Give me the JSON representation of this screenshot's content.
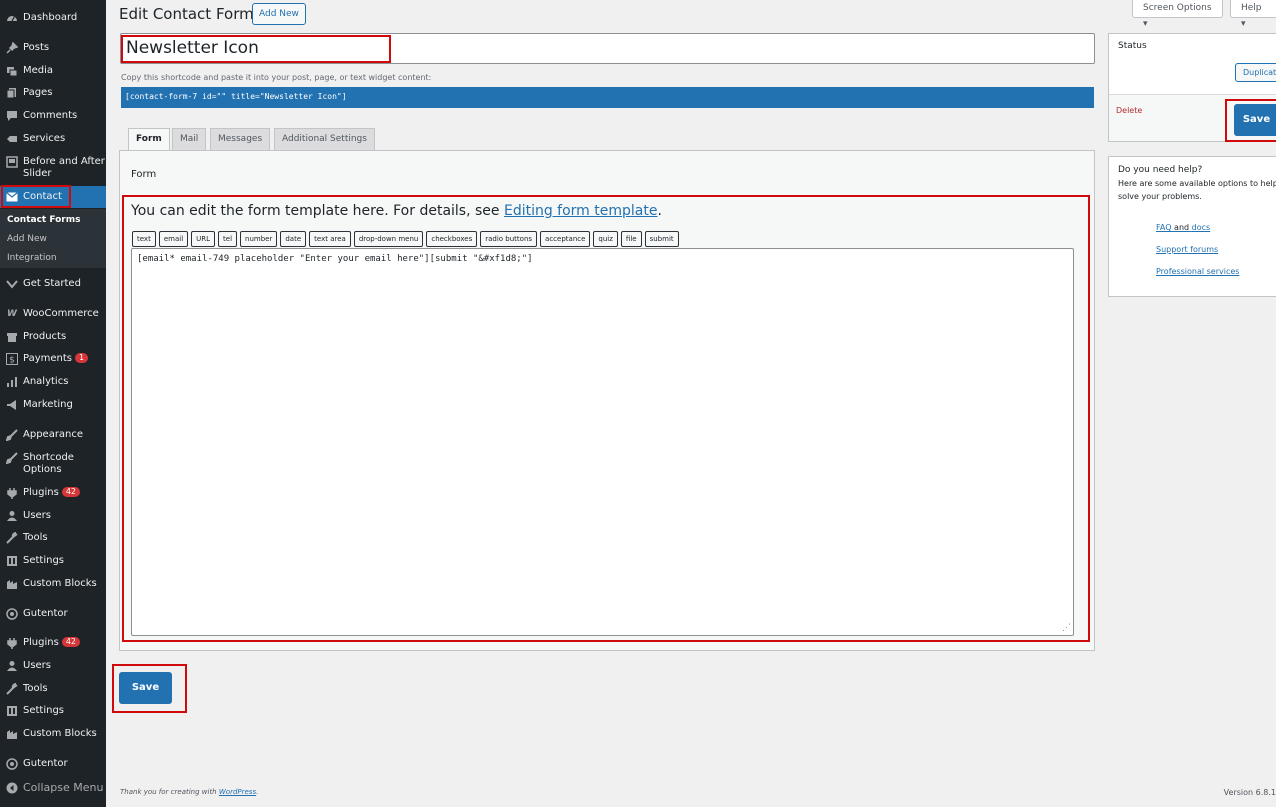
{
  "sidebar": {
    "items": [
      {
        "name": "dashboard",
        "label": "Dashboard",
        "icon": "dashboard-icon"
      },
      {
        "name": "posts",
        "label": "Posts",
        "icon": "pin-icon"
      },
      {
        "name": "media",
        "label": "Media",
        "icon": "media-icon"
      },
      {
        "name": "pages",
        "label": "Pages",
        "icon": "pages-icon"
      },
      {
        "name": "comments",
        "label": "Comments",
        "icon": "comment-icon"
      },
      {
        "name": "services",
        "label": "Services",
        "icon": "services-icon"
      },
      {
        "name": "before-after",
        "label": "Before and After Slider",
        "icon": "slider-icon"
      },
      {
        "name": "contact",
        "label": "Contact",
        "icon": "mail-icon"
      },
      {
        "name": "get-started",
        "label": "Get Started",
        "icon": "chevron-icon"
      },
      {
        "name": "woocommerce",
        "label": "WooCommerce",
        "icon": "woo-icon"
      },
      {
        "name": "products",
        "label": "Products",
        "icon": "archive-icon"
      },
      {
        "name": "payments",
        "label": "Payments",
        "icon": "dollar-icon",
        "badge": "1"
      },
      {
        "name": "analytics",
        "label": "Analytics",
        "icon": "chart-bar-icon"
      },
      {
        "name": "marketing",
        "label": "Marketing",
        "icon": "megaphone-icon"
      },
      {
        "name": "appearance",
        "label": "Appearance",
        "icon": "brush-icon"
      },
      {
        "name": "shortcode-options",
        "label": "Shortcode Options",
        "icon": "shortcode-icon"
      },
      {
        "name": "plugins",
        "label": "Plugins",
        "icon": "plugin-icon",
        "badge": "42"
      },
      {
        "name": "users",
        "label": "Users",
        "icon": "user-icon"
      },
      {
        "name": "tools",
        "label": "Tools",
        "icon": "wrench-icon"
      },
      {
        "name": "settings",
        "label": "Settings",
        "icon": "settings-icon"
      },
      {
        "name": "custom-blocks",
        "label": "Custom Blocks",
        "icon": "blocks-icon"
      },
      {
        "name": "gutentor",
        "label": "Gutentor",
        "icon": "gutentor-icon"
      },
      {
        "name": "plugins-2",
        "label": "Plugins",
        "icon": "plugin-icon",
        "badge": "42"
      },
      {
        "name": "users-2",
        "label": "Users",
        "icon": "user-icon"
      },
      {
        "name": "tools-2",
        "label": "Tools",
        "icon": "wrench-icon"
      },
      {
        "name": "settings-2",
        "label": "Settings",
        "icon": "settings-icon"
      },
      {
        "name": "custom-blocks-2",
        "label": "Custom Blocks",
        "icon": "blocks-icon"
      },
      {
        "name": "gutentor-2",
        "label": "Gutentor",
        "icon": "gutentor-icon"
      },
      {
        "name": "collapse-menu",
        "label": "Collapse Menu",
        "icon": "collapse-icon"
      }
    ],
    "submenu": [
      "Contact Forms",
      "Add New",
      "Integration"
    ]
  },
  "header": {
    "title": "Edit Contact Form",
    "add_new": "Add New",
    "screen_options": "Screen Options ▾",
    "help": "Help ▾"
  },
  "form": {
    "title_value": "Newsletter Icon",
    "shortcode_label": "Copy this shortcode and paste it into your post, page, or text widget content:",
    "shortcode": "[contact-form-7 id=\"\" title=\"Newsletter Icon\"]",
    "tabs": [
      "Form",
      "Mail",
      "Messages",
      "Additional Settings"
    ],
    "panel_heading": "Form",
    "desc_prefix": "You can edit the form template here. For details, see ",
    "desc_link": "Editing form template",
    "desc_suffix": ".",
    "tag_buttons": [
      "text",
      "email",
      "URL",
      "tel",
      "number",
      "date",
      "text area",
      "drop-down menu",
      "checkboxes",
      "radio buttons",
      "acceptance",
      "quiz",
      "file",
      "submit"
    ],
    "template": "[email* email-749 placeholder \"Enter your email here\"][submit \"&#xf1d8;\"]",
    "save": "Save"
  },
  "status_box": {
    "title": "Status",
    "duplicate": "Duplicate",
    "delete": "Delete",
    "save": "Save"
  },
  "help_box": {
    "title": "Do you need help?",
    "text": "Here are some available options to help solve your problems.",
    "faq": "FAQ",
    "and": "and",
    "docs": "docs",
    "support": "Support forums",
    "professional": "Professional services"
  },
  "footer": {
    "thanks": "Thank you for creating with",
    "wp": "WordPress",
    "period": ".",
    "version": "Version 6.8.1"
  }
}
